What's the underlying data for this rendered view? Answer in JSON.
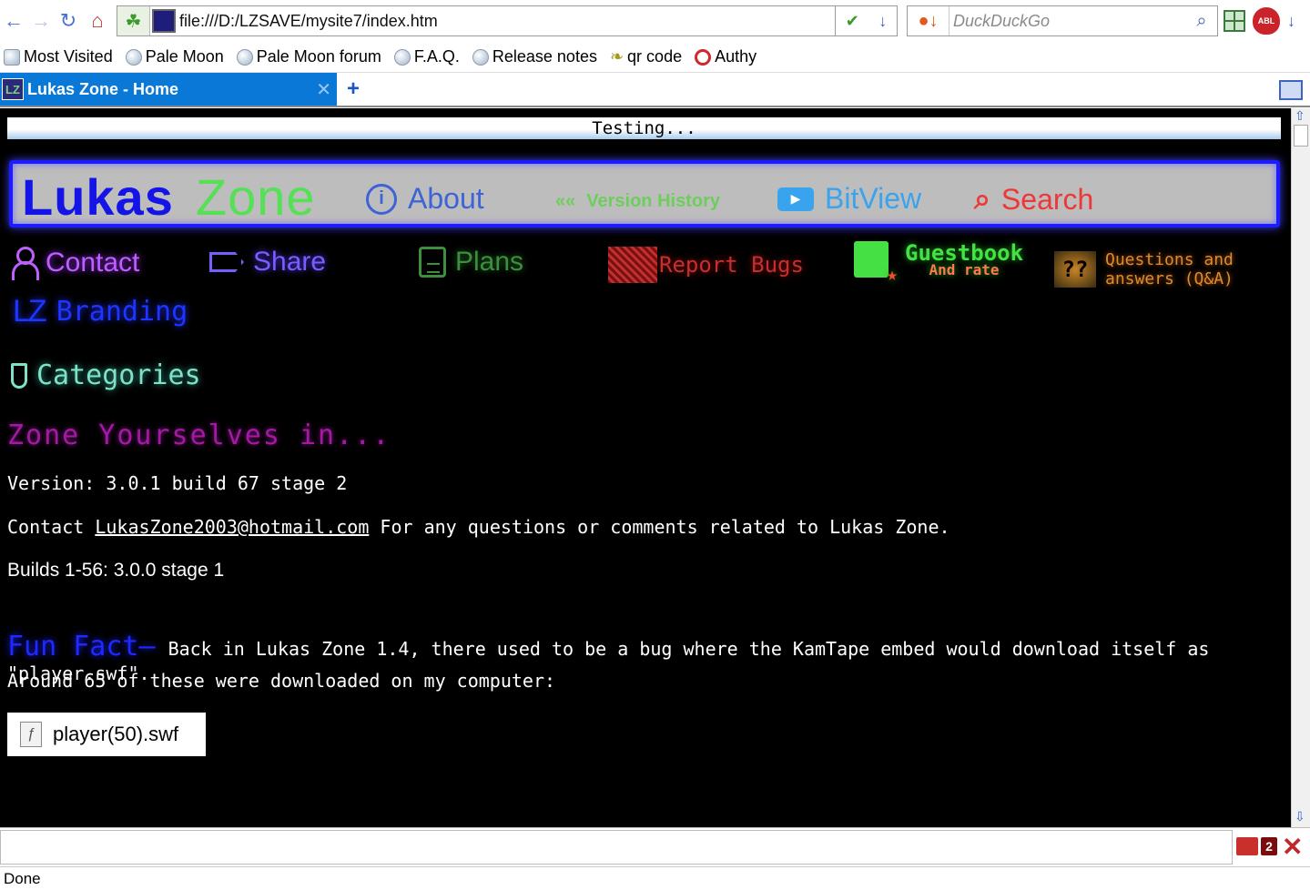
{
  "browser": {
    "url": "file:///D:/LZSAVE/mysite7/index.htm",
    "search_placeholder": "DuckDuckGo",
    "abp_label": "ABL",
    "bookmarks": [
      "Most Visited",
      "Pale Moon",
      "Pale Moon forum",
      "F.A.Q.",
      "Release notes",
      "qr code",
      "Authy"
    ],
    "tab_title": "Lukas Zone - Home",
    "tab_icon_text": "LZ",
    "new_tab_label": "+",
    "status_text": "Done",
    "addon_badge_count": "2"
  },
  "page": {
    "testing_text": "Testing...",
    "logo": {
      "part1": "Lukas",
      "part2": "Zone"
    },
    "nav": {
      "about": "About",
      "version_history": "Version History",
      "version_icon": "««",
      "bitview": "BitView",
      "search": "Search"
    },
    "links": {
      "contact": "Contact",
      "share": "Share",
      "plans": "Plans",
      "report_bugs": "Report Bugs",
      "guestbook": "Guestbook",
      "guestbook_sub": "And rate",
      "qa_line1": "Questions and",
      "qa_line2": "answers (Q&A)",
      "qa_icon": "??",
      "branding": "Branding",
      "branding_icon": "LZ"
    },
    "categories": "Categories",
    "headline": "Zone Yourselves in...",
    "version_line": "Version: 3.0.1 build 67 stage 2",
    "contact_prefix": "Contact",
    "contact_email": "LukasZone2003@hotmail.com",
    "contact_suffix": "For any questions or comments related to Lukas Zone.",
    "builds_line": "Builds 1-56:  3.0.0 stage 1",
    "fun_fact_title": "Fun Fact—",
    "fun_fact_line1": "Back in Lukas Zone 1.4, there used to be a bug where the KamTape embed would download itself as \"player.swf\".",
    "fun_fact_line2": "Around 65 of these were downloaded on my computer:",
    "file_name": "player(50).swf"
  },
  "colors": {
    "tab_active": "#0a78d7",
    "page_bg": "#000000",
    "banner_border": "#1c1cff"
  }
}
